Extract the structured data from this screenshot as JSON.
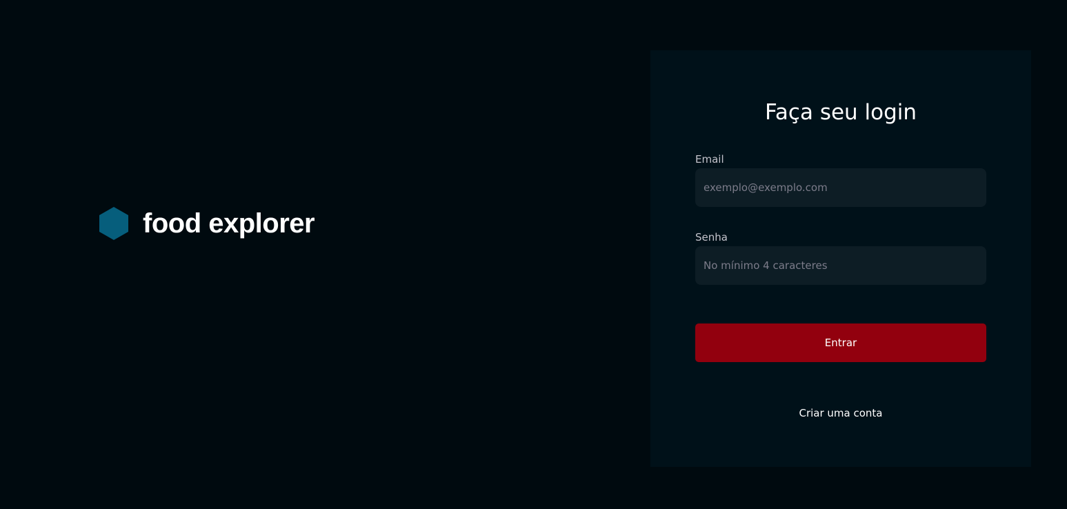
{
  "brand": {
    "name": "food explorer",
    "icon": "hexagon-logo-icon",
    "icon_color": "#065e7c"
  },
  "login": {
    "title": "Faça seu login",
    "email": {
      "label": "Email",
      "placeholder": "exemplo@exemplo.com",
      "value": ""
    },
    "password": {
      "label": "Senha",
      "placeholder": "No mínimo 4 caracteres",
      "value": ""
    },
    "submit_label": "Entrar",
    "signup_label": "Criar uma conta"
  },
  "colors": {
    "background": "#000a0f",
    "card": "#001119",
    "input": "#0d1d25",
    "primary_button": "#92000e",
    "label_text": "#c4c4cc",
    "placeholder_text": "#7c7c8a"
  }
}
